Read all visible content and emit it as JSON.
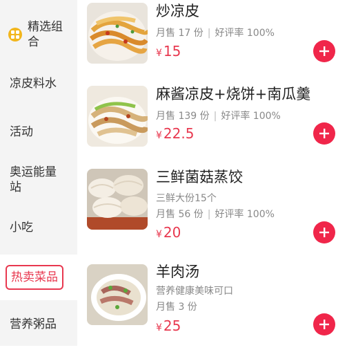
{
  "sidebar": {
    "categories": [
      {
        "label": "精选组合",
        "icon": "grid-icon"
      },
      {
        "label": "凉皮料水"
      },
      {
        "label": "活动"
      },
      {
        "label": "奥运能量站"
      },
      {
        "label": "小吃"
      },
      {
        "label": "热卖菜品",
        "active": true
      },
      {
        "label": "营养粥品"
      }
    ]
  },
  "menu": {
    "items": [
      {
        "name": "炒凉皮",
        "sales": "月售 17 份",
        "rating": "好评率 100%",
        "currency": "¥",
        "price": "15"
      },
      {
        "name": "麻酱凉皮+烧饼+南瓜羹",
        "sales": "月售 139 份",
        "rating": "好评率 100%",
        "currency": "¥",
        "price": "22.5"
      },
      {
        "name": "三鲜菌菇蒸饺",
        "desc": "三鲜大份15个",
        "sales": "月售 56 份",
        "rating": "好评率 100%",
        "currency": "¥",
        "price": "20"
      },
      {
        "name": "羊肉汤",
        "desc": "营养健康美味可口",
        "sales": "月售 3 份",
        "currency": "¥",
        "price": "25"
      }
    ],
    "add_icon": "plus-icon"
  },
  "colors": {
    "accent": "#e8384f",
    "add_button": "#f0264a",
    "sidebar_bg": "#f4f4f4",
    "icon_yellow": "#f2b61d"
  }
}
